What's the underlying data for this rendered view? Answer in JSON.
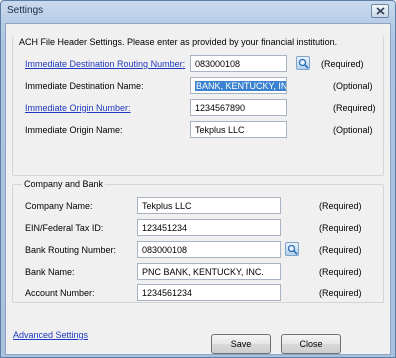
{
  "window": {
    "title": "Settings"
  },
  "ach_group": {
    "heading": "ACH File Header Settings.  Please enter as provided by your financial institution.",
    "rows": [
      {
        "label": "Immediate Destination Routing Number:",
        "value": "083000108",
        "note": "(Required)"
      },
      {
        "label": "Immediate Destination Name:",
        "value": "BANK, KENTUCKY, INC",
        "note": "(Optional)"
      },
      {
        "label": "Immediate Origin Number:",
        "value": "1234567890",
        "note": "(Required)"
      },
      {
        "label": "Immediate Origin Name:",
        "value": "Tekplus LLC",
        "note": "(Optional)"
      }
    ]
  },
  "company_group": {
    "heading": "Company and Bank",
    "rows": [
      {
        "label": "Company Name:",
        "value": "Tekplus LLC",
        "note": "(Required)"
      },
      {
        "label": "EIN/Federal Tax ID:",
        "value": "123451234",
        "note": "(Required)"
      },
      {
        "label": "Bank Routing Number:",
        "value": "083000108",
        "note": "(Required)"
      },
      {
        "label": "Bank Name:",
        "value": "PNC BANK, KENTUCKY, INC.",
        "note": "(Required)"
      },
      {
        "label": "Account Number:",
        "value": "1234561234",
        "note": "(Required)"
      }
    ]
  },
  "footer": {
    "advanced_link": "Advanced Settings",
    "save_label": "Save",
    "close_label": "Close"
  },
  "icons": {
    "lookup": "magnifier-lookup-icon",
    "window_close": "close-icon"
  }
}
